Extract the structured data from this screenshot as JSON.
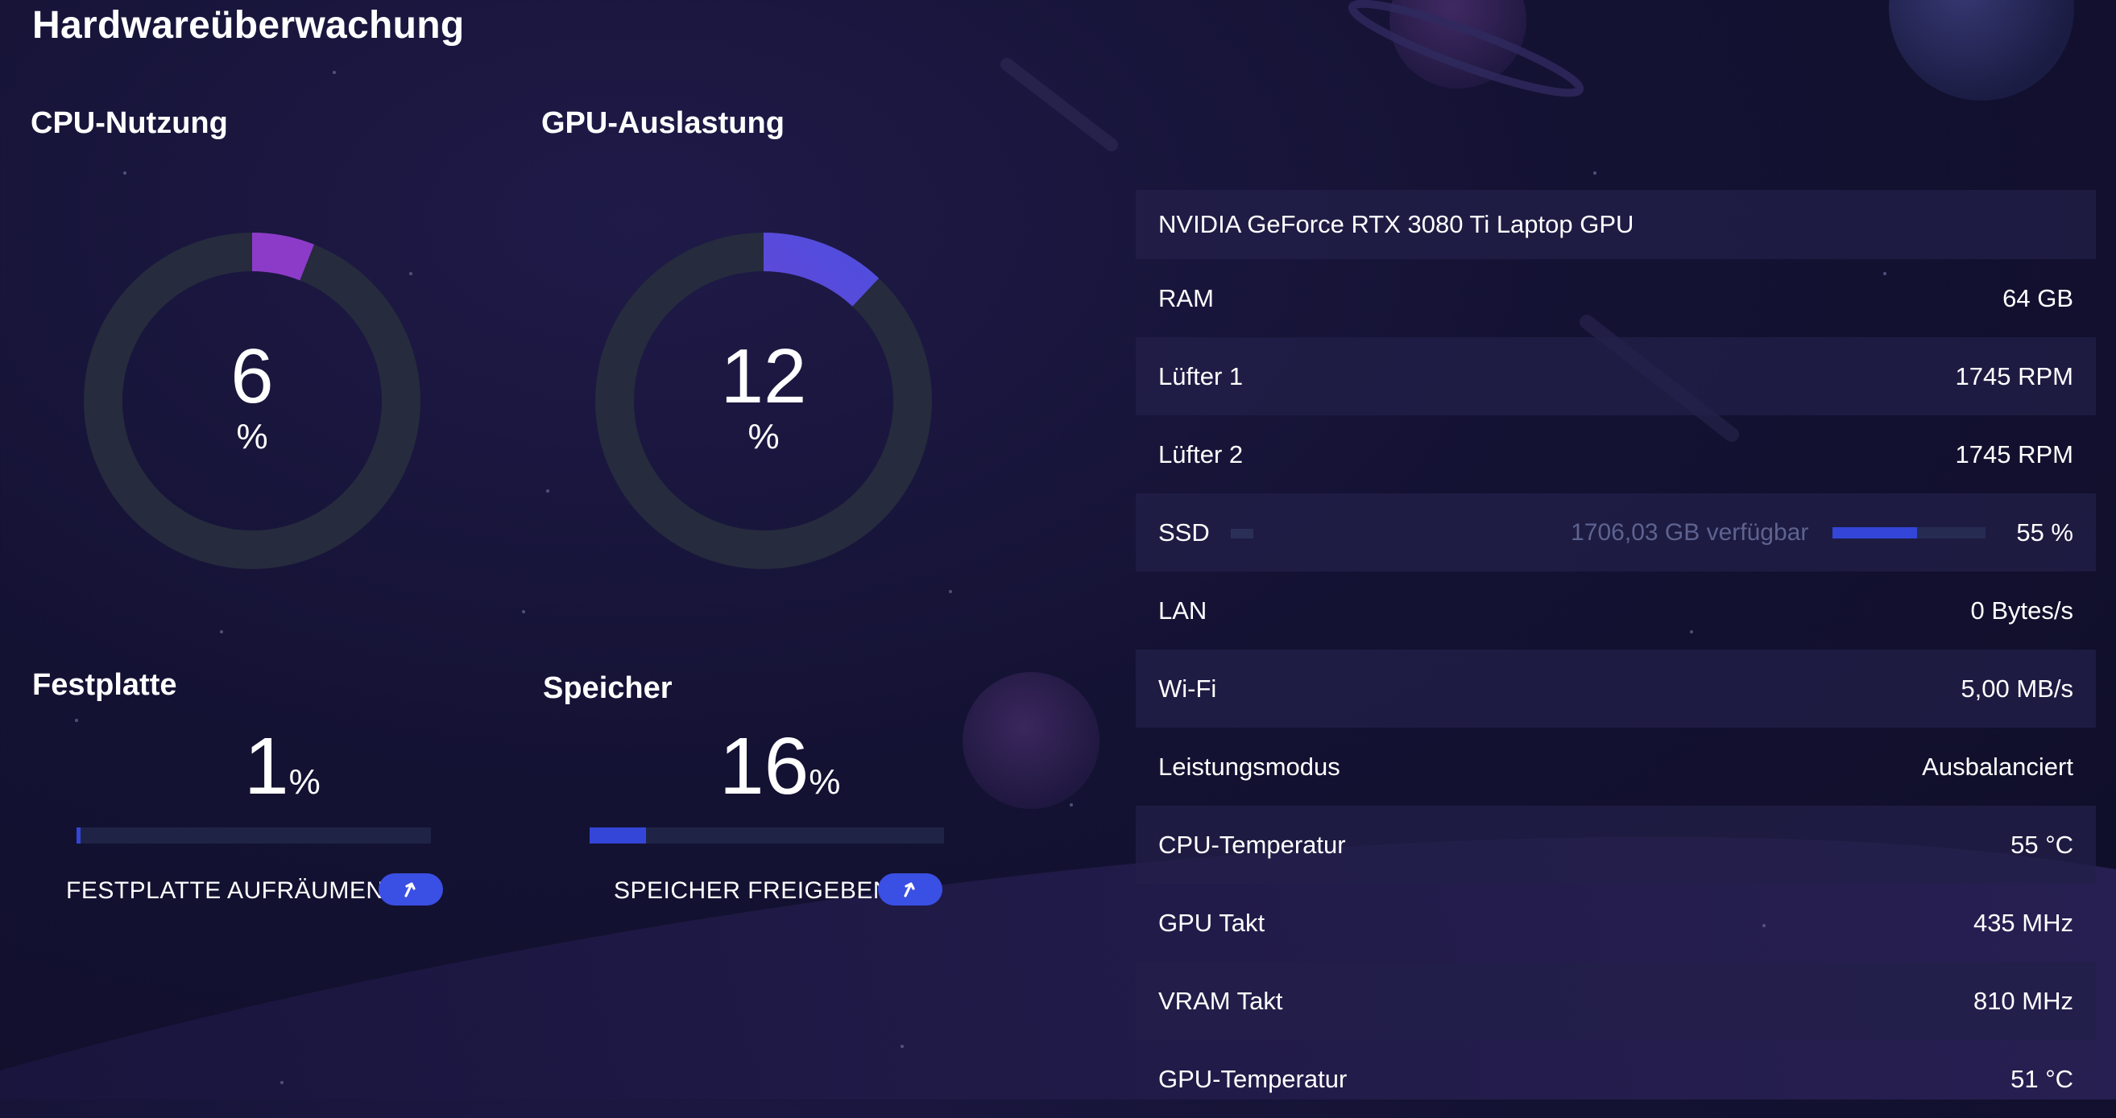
{
  "app": {
    "title": "Hardwareüberwachung"
  },
  "colors": {
    "accent": "#3346d8",
    "ring_track": "#262b3d",
    "ring_from": "#8c3bc8",
    "ring_to": "#4a4fe0",
    "row_bg": "#22204a"
  },
  "cpu": {
    "title": "CPU-Nutzung",
    "value": "6",
    "unit": "%",
    "fraction": 0.06
  },
  "gpu": {
    "title": "GPU-Auslastung",
    "value": "12",
    "unit": "%",
    "fraction": 0.12
  },
  "disk": {
    "title": "Festplatte",
    "value": "1",
    "unit": "%",
    "fraction": 0.01,
    "action_label": "FESTPLATTE AUFRÄUMEN",
    "action_icon": "arrow-up-icon"
  },
  "memory": {
    "title": "Speicher",
    "value": "16",
    "unit": "%",
    "fraction": 0.16,
    "action_label": "SPEICHER FREIGEBEN",
    "action_icon": "arrow-up-icon"
  },
  "info": {
    "gpu_name": "NVIDIA GeForce RTX 3080 Ti Laptop GPU",
    "rows": [
      {
        "label": "RAM",
        "value": "64 GB"
      },
      {
        "label": "Lüfter 1",
        "value": "1745 RPM"
      },
      {
        "label": "Lüfter 2",
        "value": "1745 RPM"
      },
      {
        "label": "SSD",
        "available": "1706,03 GB verfügbar",
        "value": "55 %",
        "fraction": 0.55
      },
      {
        "label": "LAN",
        "value": "0 Bytes/s"
      },
      {
        "label": "Wi-Fi",
        "value": "5,00 MB/s"
      },
      {
        "label": "Leistungsmodus",
        "value": "Ausbalanciert"
      },
      {
        "label": "CPU-Temperatur",
        "value": "55 °C"
      },
      {
        "label": "GPU Takt",
        "value": "435 MHz"
      },
      {
        "label": "VRAM Takt",
        "value": "810 MHz"
      },
      {
        "label": "GPU-Temperatur",
        "value": "51 °C"
      }
    ]
  }
}
